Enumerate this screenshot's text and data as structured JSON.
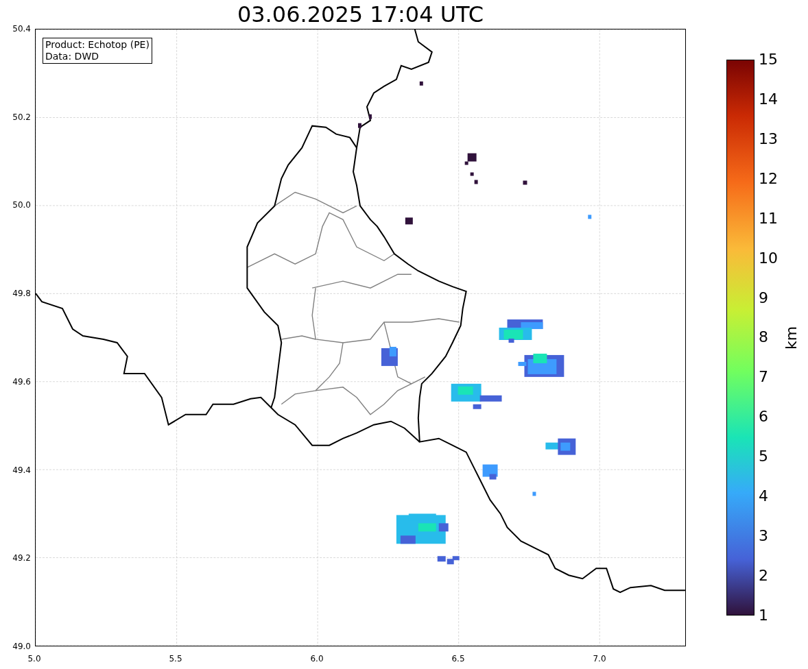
{
  "title": "03.06.2025 17:04 UTC",
  "legend": [
    "Product: Echotop (PE)",
    "Data: DWD"
  ],
  "xticks": [
    "5.0",
    "5.5",
    "6.0",
    "6.5",
    "7.0"
  ],
  "yticks": [
    "50.4",
    "50.2",
    "50.0",
    "49.8",
    "49.6",
    "49.4",
    "49.2",
    "49.0"
  ],
  "colorbar": {
    "label": "km",
    "ticks": [
      "15",
      "14",
      "13",
      "12",
      "11",
      "10",
      "9",
      "8",
      "7",
      "6",
      "5",
      "4",
      "3",
      "2",
      "1"
    ]
  }
}
